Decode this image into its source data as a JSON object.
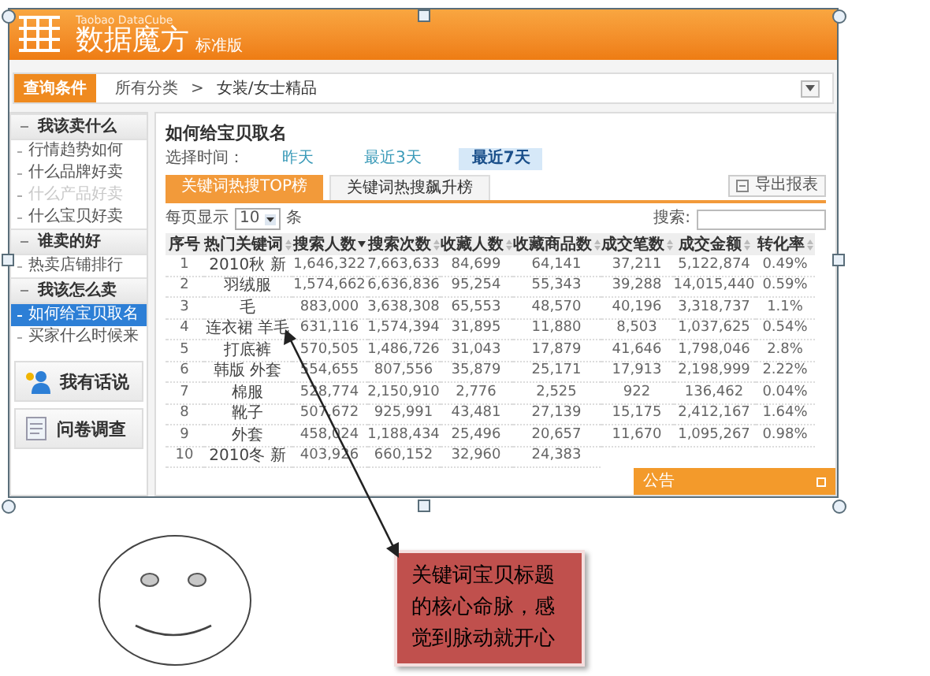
{
  "header": {
    "subtitle": "Taobao DataCube",
    "title": "数据魔方",
    "edition": "标准版"
  },
  "query_bar": {
    "label": "查询条件",
    "breadcrumb": [
      "所有分类",
      "女装/女士精品"
    ],
    "separator": ">"
  },
  "sidebar": {
    "sections": [
      {
        "title": "我该卖什么",
        "expanded": true,
        "items": [
          {
            "label": "行情趋势如何",
            "selected": false,
            "disabled": false
          },
          {
            "label": "什么品牌好卖",
            "selected": false,
            "disabled": false
          },
          {
            "label": "什么产品好卖",
            "selected": false,
            "disabled": true
          },
          {
            "label": "什么宝贝好卖",
            "selected": false,
            "disabled": false
          }
        ]
      },
      {
        "title": "谁卖的好",
        "expanded": true,
        "items": [
          {
            "label": "热卖店铺排行",
            "selected": false,
            "disabled": false
          }
        ]
      },
      {
        "title": "我该怎么卖",
        "expanded": true,
        "items": [
          {
            "label": "如何给宝贝取名",
            "selected": true,
            "disabled": false
          },
          {
            "label": "买家什么时候来",
            "selected": false,
            "disabled": false
          }
        ]
      }
    ],
    "widgets": [
      {
        "label": "我有话说",
        "kind": "chat"
      },
      {
        "label": "问卷调查",
        "kind": "survey"
      }
    ]
  },
  "main": {
    "title": "如何给宝贝取名",
    "time_label": "选择时间：",
    "time_options": [
      {
        "label": "昨天",
        "selected": false
      },
      {
        "label": "最近3天",
        "selected": false
      },
      {
        "label": "最近7天",
        "selected": true
      }
    ],
    "tabs": [
      {
        "label": "关键词热搜TOP榜",
        "selected": true
      },
      {
        "label": "关键词热搜飙升榜",
        "selected": false
      }
    ],
    "export_button": "导出报表",
    "page_size": {
      "prefix": "每页显示",
      "value": "10",
      "suffix": "条"
    },
    "search": {
      "label": "搜索:"
    },
    "table": {
      "columns": [
        {
          "label": "序号",
          "sortable": false,
          "sorted": false
        },
        {
          "label": "热门关键词",
          "sortable": true,
          "sorted": false
        },
        {
          "label": "搜索人数",
          "sortable": true,
          "sorted": true
        },
        {
          "label": "搜索次数",
          "sortable": true,
          "sorted": false
        },
        {
          "label": "收藏人数",
          "sortable": true,
          "sorted": false
        },
        {
          "label": "收藏商品数",
          "sortable": true,
          "sorted": false
        },
        {
          "label": "成交笔数",
          "sortable": true,
          "sorted": false
        },
        {
          "label": "成交金额",
          "sortable": true,
          "sorted": false
        },
        {
          "label": "转化率",
          "sortable": true,
          "sorted": false
        }
      ],
      "rows": [
        [
          "1",
          "2010秋 新",
          "1,646,322",
          "7,663,633",
          "84,699",
          "64,141",
          "37,211",
          "5,122,874",
          "0.49%"
        ],
        [
          "2",
          "羽绒服",
          "1,574,662",
          "6,636,836",
          "95,254",
          "55,343",
          "39,288",
          "14,015,440",
          "0.59%"
        ],
        [
          "3",
          "毛",
          "883,000",
          "3,638,308",
          "65,553",
          "48,570",
          "40,196",
          "3,318,737",
          "1.1%"
        ],
        [
          "4",
          "连衣裙 羊毛",
          "631,116",
          "1,574,394",
          "31,895",
          "11,880",
          "8,503",
          "1,037,625",
          "0.54%"
        ],
        [
          "5",
          "打底裤",
          "570,505",
          "1,486,726",
          "31,043",
          "17,879",
          "41,646",
          "1,798,046",
          "2.8%"
        ],
        [
          "6",
          "韩版 外套",
          "554,655",
          "807,556",
          "35,879",
          "25,171",
          "17,913",
          "2,198,999",
          "2.22%"
        ],
        [
          "7",
          "棉服",
          "528,774",
          "2,150,910",
          "2,776",
          "2,525",
          "922",
          "136,462",
          "0.04%"
        ],
        [
          "8",
          "靴子",
          "507,672",
          "925,991",
          "43,481",
          "27,139",
          "15,175",
          "2,412,167",
          "1.64%"
        ],
        [
          "9",
          "外套",
          "458,024",
          "1,188,434",
          "25,496",
          "20,657",
          "11,670",
          "1,095,267",
          "0.98%"
        ],
        [
          "10",
          "2010冬 新",
          "403,926",
          "660,152",
          "32,960",
          "24,383"
        ]
      ]
    },
    "notice": {
      "label": "公告"
    }
  },
  "annotation": {
    "callout": "关键词宝贝标题的核心命脉，感觉到脉动就开心"
  }
}
